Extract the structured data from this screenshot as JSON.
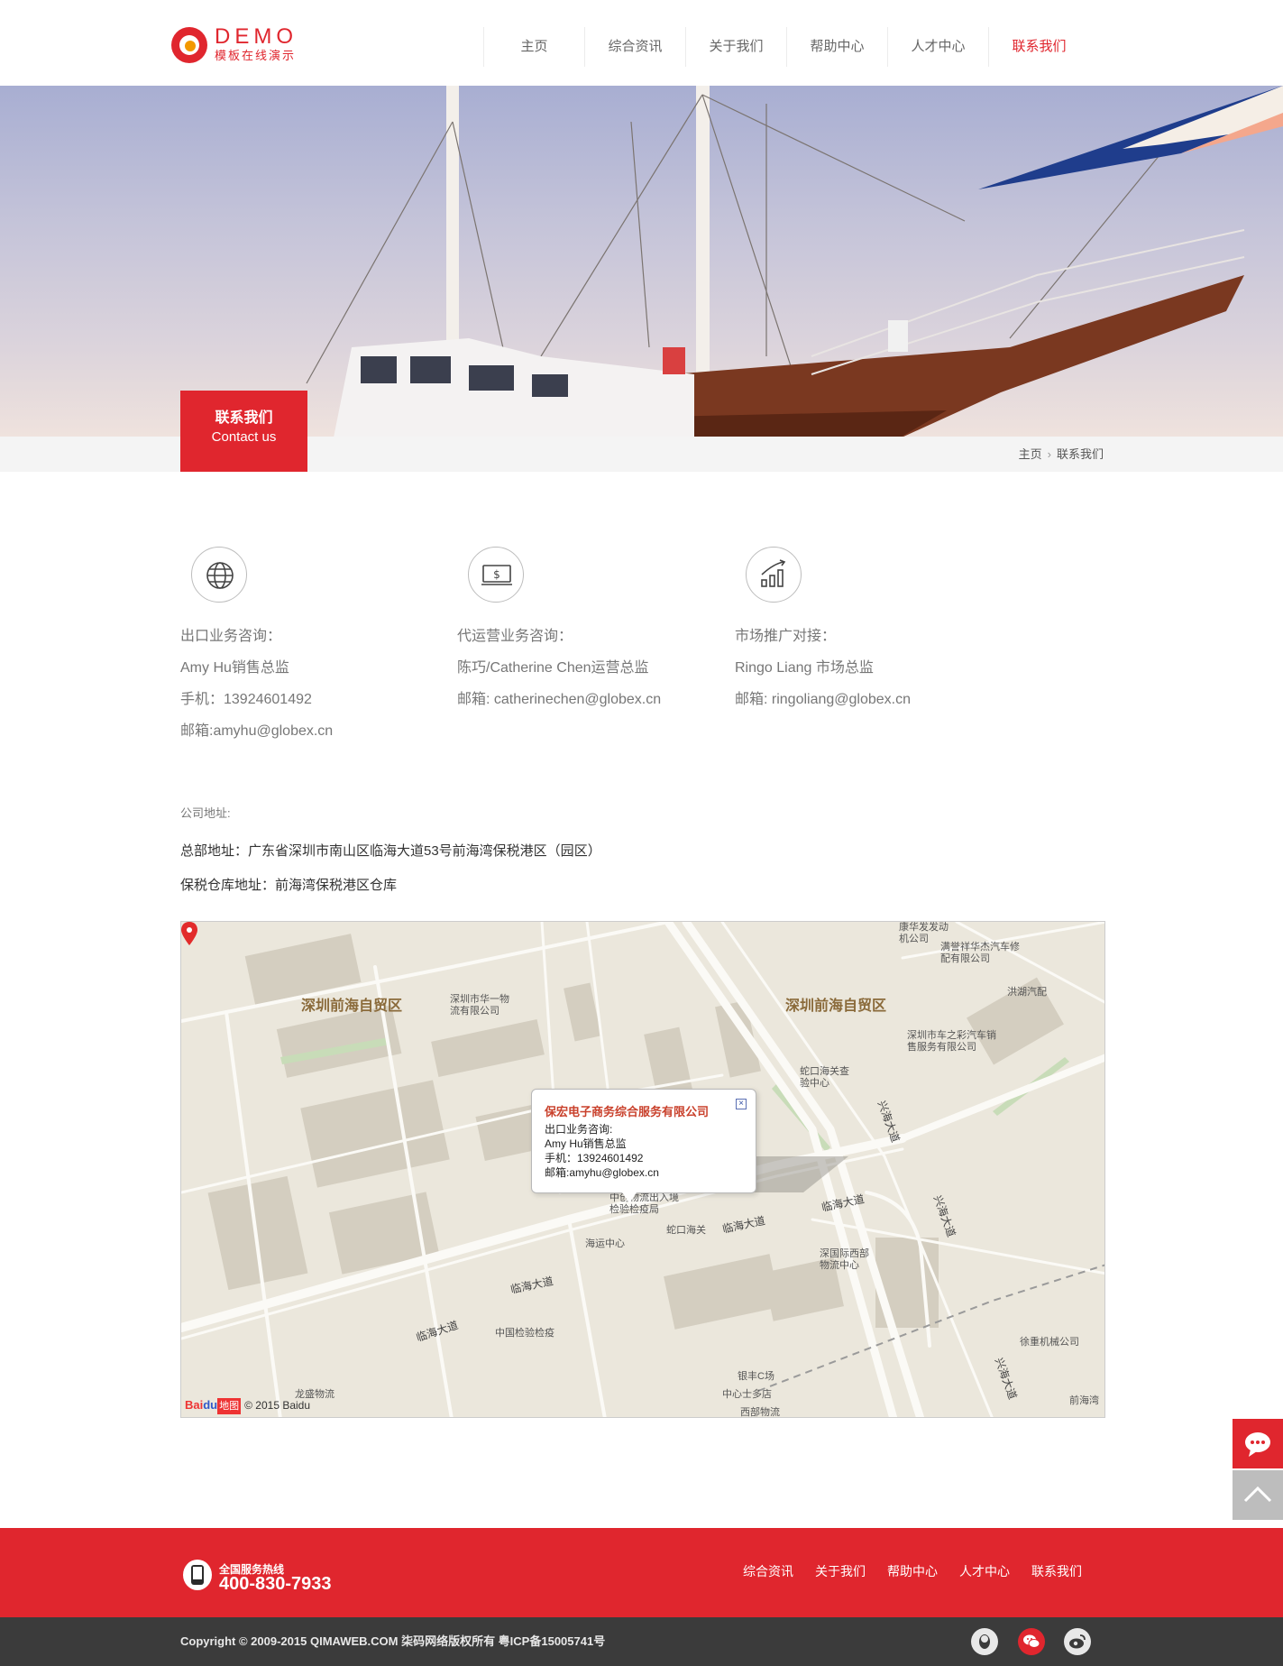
{
  "header": {
    "logo_title": "DEMO",
    "logo_subtitle": "模板在线演示",
    "nav": [
      {
        "label": "主页"
      },
      {
        "label": "综合资讯"
      },
      {
        "label": "关于我们"
      },
      {
        "label": "帮助中心"
      },
      {
        "label": "人才中心"
      },
      {
        "label": "联系我们",
        "active": true
      }
    ]
  },
  "banner": {
    "title_cn": "联系我们",
    "title_en": "Contact us"
  },
  "breadcrumb": [
    "主页",
    "联系我们"
  ],
  "contacts": [
    {
      "icon": "globe-icon",
      "lines": [
        "出口业务咨询：",
        "Amy Hu销售总监",
        "手机：13924601492",
        "邮箱:amyhu@globex.cn"
      ]
    },
    {
      "icon": "dollar-screen-icon",
      "lines": [
        "代运营业务咨询：",
        "陈巧/Catherine Chen运营总监",
        "邮箱: catherinechen@globex.cn"
      ]
    },
    {
      "icon": "chart-growth-icon",
      "lines": [
        "市场推广对接：",
        "Ringo Liang 市场总监",
        "邮箱: ringoliang@globex.cn"
      ]
    }
  ],
  "address": {
    "label": "公司地址:",
    "hq": "总部地址：广东省深圳市南山区临海大道53号前海湾保税港区（园区）",
    "warehouse": "保税仓库地址：前海湾保税港区仓库"
  },
  "map": {
    "popup": {
      "title": "保宏电子商务综合服务有限公司",
      "lines": [
        "出口业务咨询:",
        "Amy Hu销售总监",
        "手机：13924601492",
        "邮箱:amyhu@globex.cn"
      ]
    },
    "labels": {
      "zone_left": "深圳前海自贸区",
      "zone_right": "深圳前海自贸区",
      "huayi": "深圳市华一物流有限公司",
      "kanghua": "康华发发动机公司",
      "yujing": "满誉祥华杰汽车修配有限公司",
      "hongchu": "洪湖汽配",
      "chezhicai": "深圳市车之彩汽车销售服务有限公司",
      "shekou_customs": "蛇口海关查验中心",
      "zhongchuang": "中创物流出入境检验检疫局",
      "haiyun": "海运中心",
      "shekou_hg": "蛇口海关",
      "sz_intl": "深国际西部物流中心",
      "cn_jyjy": "中国检验检疫",
      "longsheng": "龙盛物流",
      "yinfeng": "银丰C场",
      "zhongxin": "中心士多店",
      "xibu": "西部物流",
      "xuzhong": "徐重机械公司",
      "qianhai_right": "前海湾",
      "road_linhai": "临海大道",
      "road_xinghai": "兴海大道"
    },
    "copyright": "© 2015 Baidu",
    "logo_text": [
      "Bai",
      "du",
      "地图"
    ]
  },
  "footer": {
    "hotline_label": "全国服务热线",
    "hotline": "400-830-7933",
    "nav": [
      "综合资讯",
      "关于我们",
      "帮助中心",
      "人才中心",
      "联系我们"
    ],
    "copyright": "Copyright © 2009-2015 QIMAWEB.COM 柒码网络版权所有 粤ICP备15005741号"
  },
  "colors": {
    "brand_red": "#e0262e",
    "footer_dark": "#3b3b3b"
  }
}
